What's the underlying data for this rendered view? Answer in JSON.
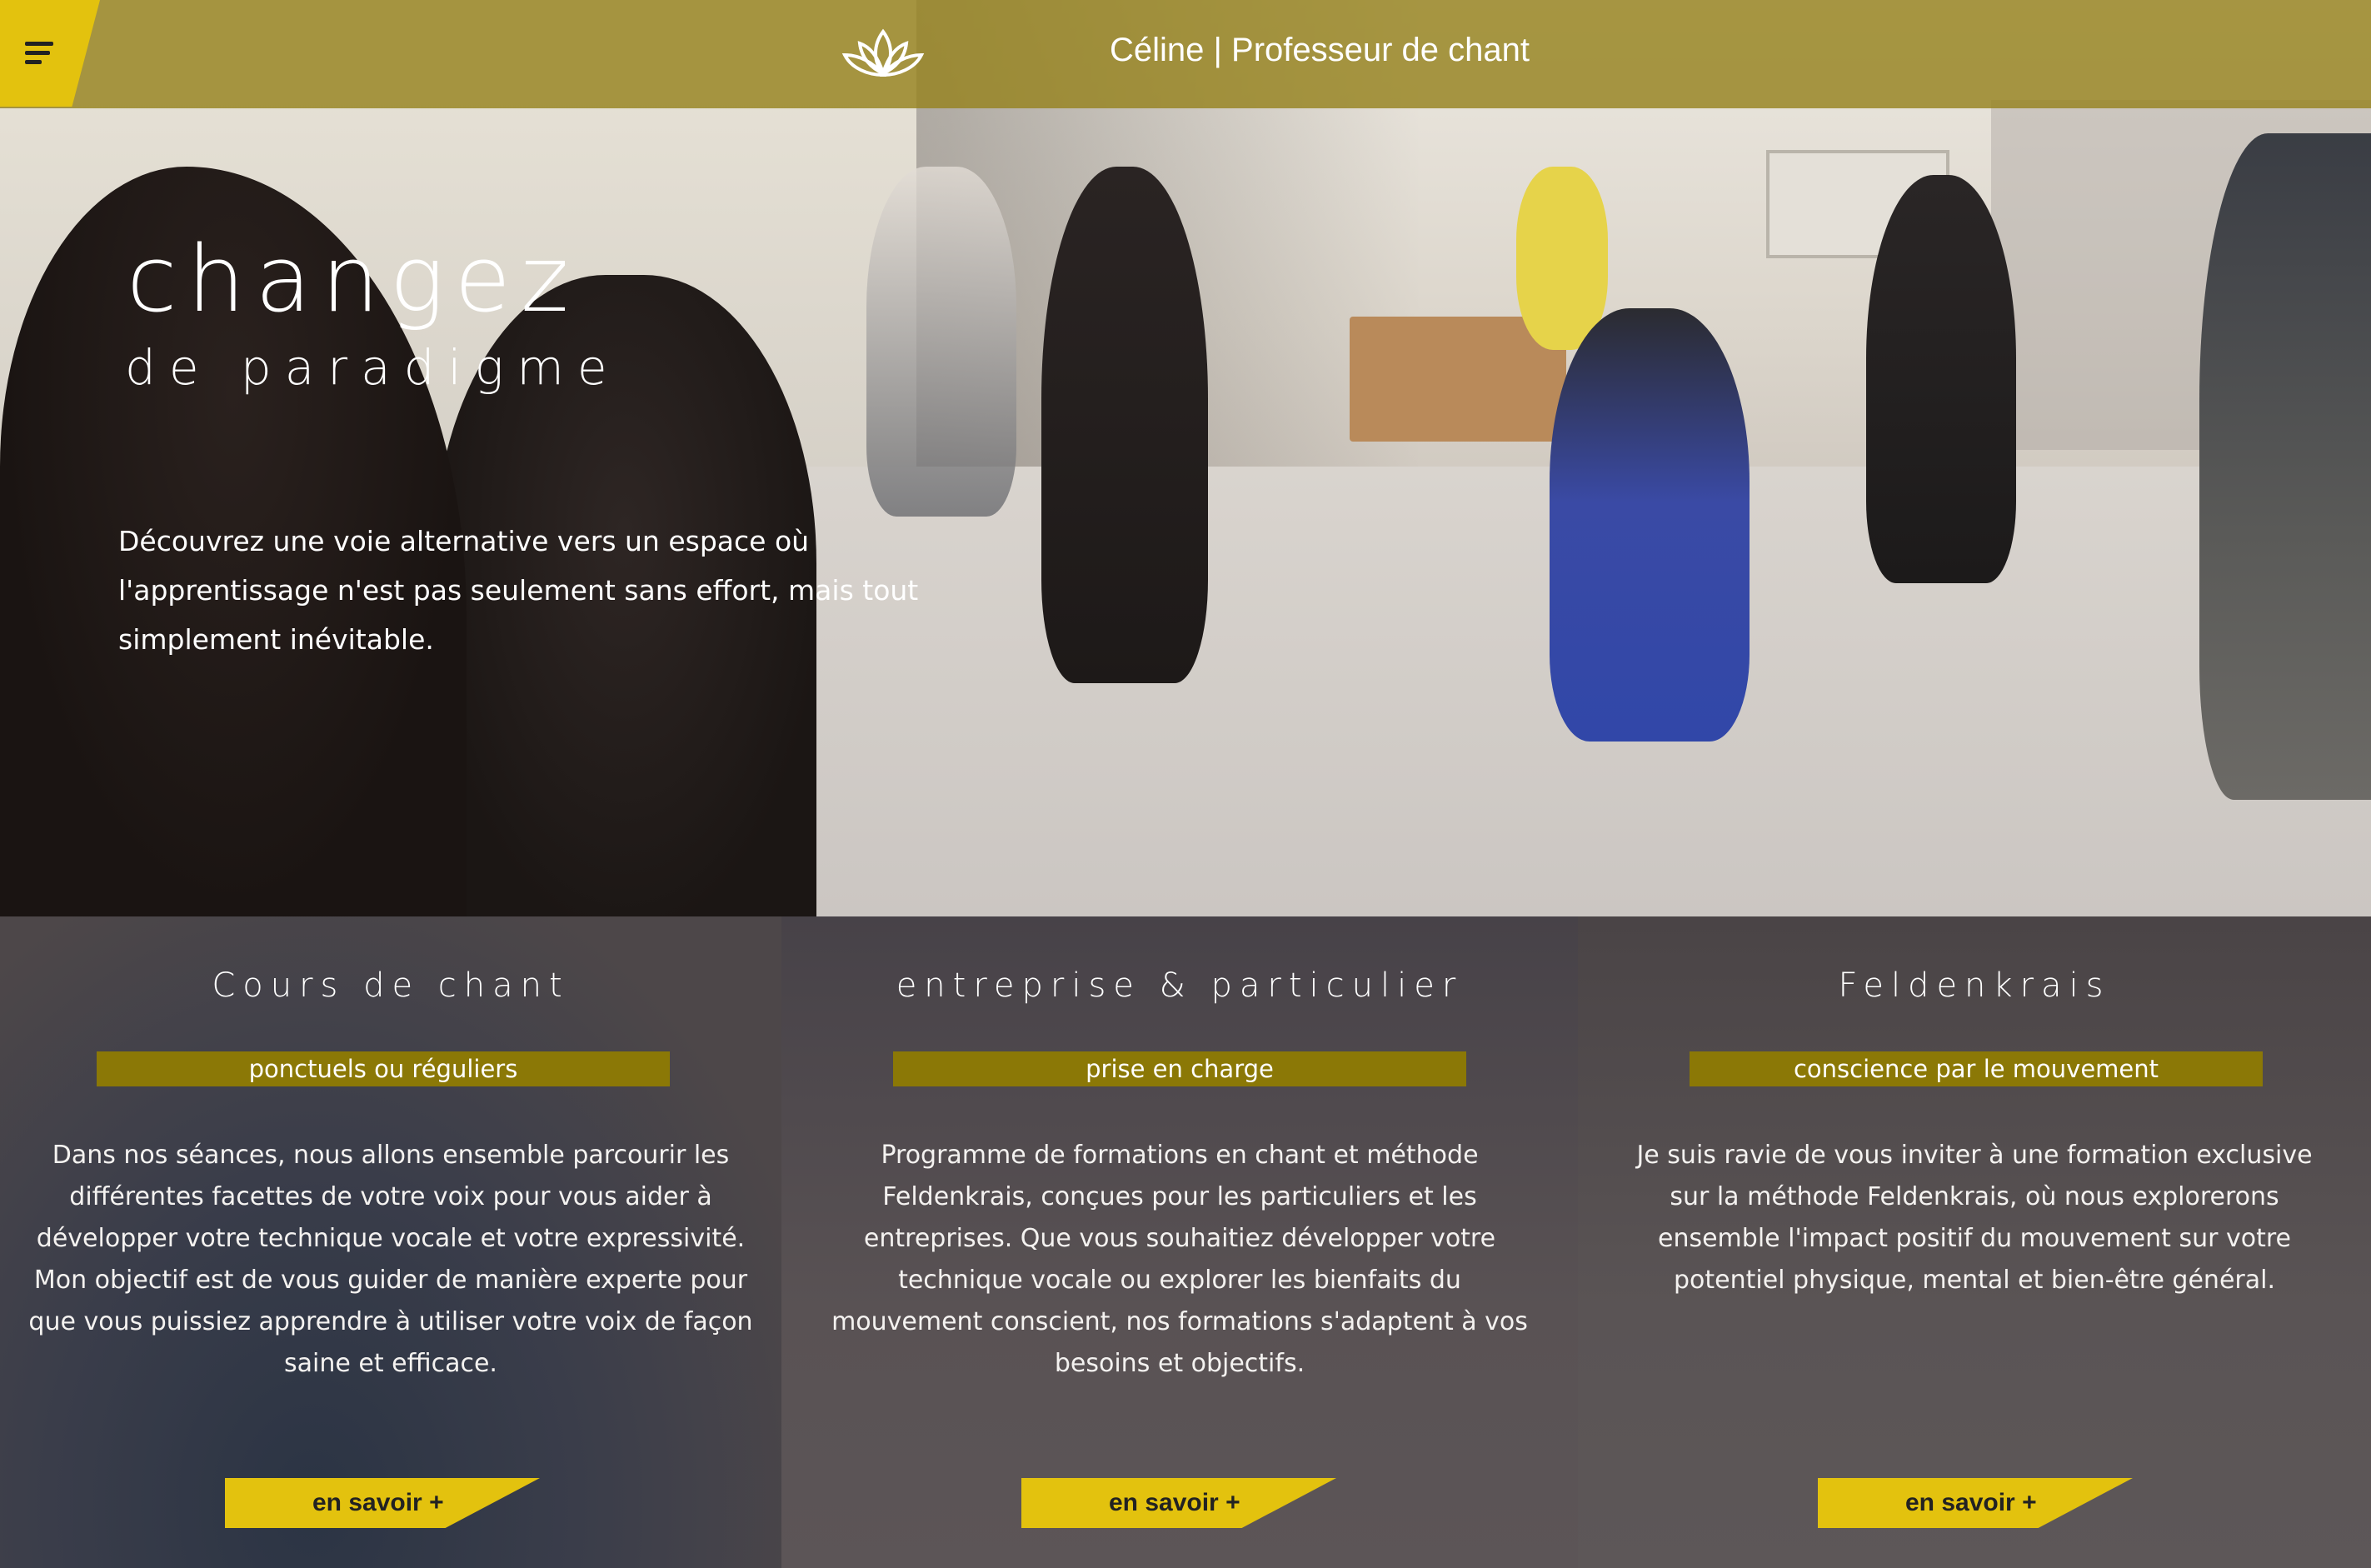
{
  "header": {
    "title": "Céline | Professeur de chant",
    "menu_icon": "menu-icon",
    "logo_icon": "lotus-icon",
    "bar_color": "#968220",
    "accent": "#e3c20e"
  },
  "hero": {
    "heading": "changez",
    "subheading": "de paradigme",
    "text": "Découvrez une voie alternative vers un espace où l'apprentissage n'est pas seulement sans effort, mais tout simplement inévitable."
  },
  "cards": [
    {
      "title": "Cours de chant",
      "tag": "ponctuels ou réguliers",
      "body": "Dans nos séances, nous allons ensemble parcourir les différentes facettes de votre voix pour vous aider à développer votre technique vocale et votre expressivité. Mon objectif est de vous guider de manière experte pour que vous puissiez apprendre à utiliser votre voix de façon saine et efficace.",
      "button": "en savoir +"
    },
    {
      "title": "entreprise & particulier",
      "tag": "prise en charge",
      "body": "Programme de formations en chant et méthode Feldenkrais, conçues pour les particuliers et les entreprises. Que vous souhaitiez développer votre technique vocale ou explorer les bienfaits du mouvement conscient, nos formations s'adaptent à vos besoins et objectifs.",
      "button": "en savoir +"
    },
    {
      "title": "Feldenkrais",
      "tag": "conscience par le mouvement",
      "body": "Je suis ravie de vous inviter à une formation exclusive sur la méthode Feldenkrais, où nous explorerons ensemble l'impact positif du mouvement sur votre potentiel physique, mental et bien-être général.",
      "button": "en savoir +"
    }
  ]
}
